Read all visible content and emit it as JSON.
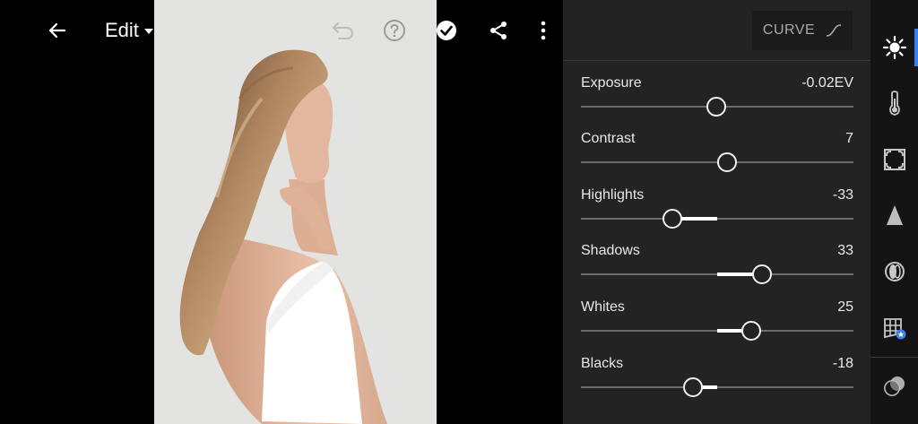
{
  "topbar": {
    "edit_label": "Edit",
    "icons": [
      "back-arrow-icon",
      "undo-icon",
      "help-icon",
      "done-check-icon",
      "share-icon",
      "more-vertical-icon"
    ]
  },
  "panel": {
    "curve_label": "CURVE",
    "adjustments": [
      {
        "label": "Exposure",
        "value": "-0.02EV",
        "level": 0.497
      },
      {
        "label": "Contrast",
        "value": "7",
        "level": 0.535
      },
      {
        "label": "Highlights",
        "value": "-33",
        "level": 0.335
      },
      {
        "label": "Shadows",
        "value": "33",
        "level": 0.665
      },
      {
        "label": "Whites",
        "value": "25",
        "level": 0.625
      },
      {
        "label": "Blacks",
        "value": "-18",
        "level": 0.41
      }
    ]
  },
  "sidebar": {
    "active_color": "#3b7ff0",
    "items": [
      "light-icon",
      "color-thermometer-icon",
      "effects-vignette-icon",
      "detail-icon",
      "optics-lens-icon",
      "geometry-grid-icon",
      "presets-icon"
    ]
  }
}
